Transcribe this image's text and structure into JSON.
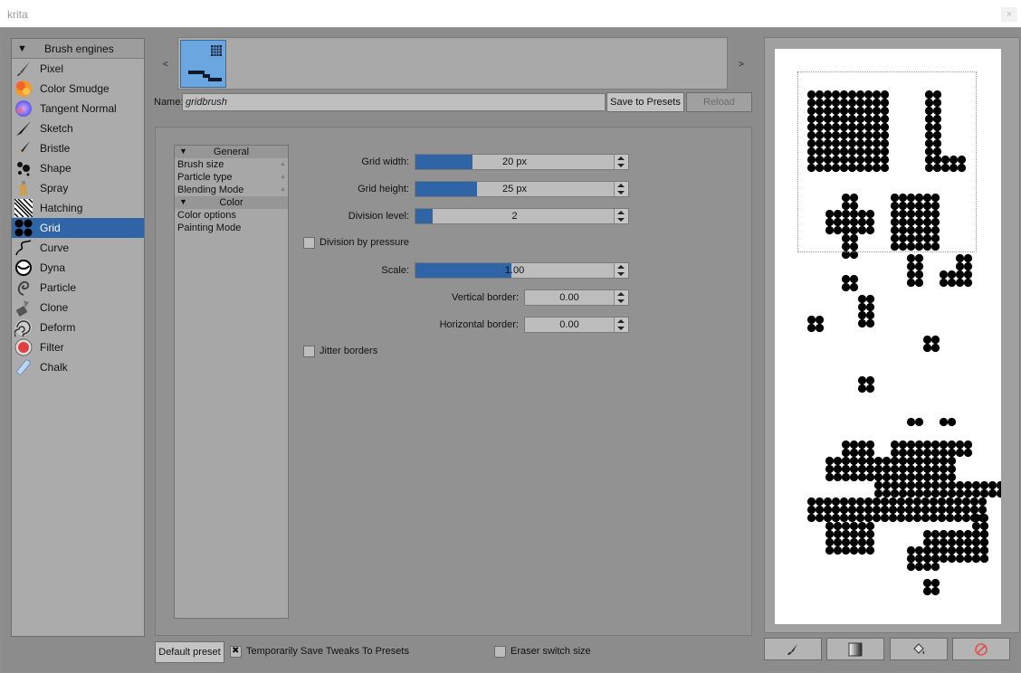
{
  "window": {
    "title": "krita",
    "close_label": "×"
  },
  "engines": {
    "header": "Brush engines",
    "items": [
      {
        "label": "Pixel",
        "icon": "pixel-brush-icon"
      },
      {
        "label": "Color Smudge",
        "icon": "color-smudge-icon"
      },
      {
        "label": "Tangent Normal",
        "icon": "tangent-normal-icon"
      },
      {
        "label": "Sketch",
        "icon": "sketch-icon"
      },
      {
        "label": "Bristle",
        "icon": "bristle-icon"
      },
      {
        "label": "Shape",
        "icon": "shape-icon"
      },
      {
        "label": "Spray",
        "icon": "spray-icon"
      },
      {
        "label": "Hatching",
        "icon": "hatching-icon"
      },
      {
        "label": "Grid",
        "icon": "grid-icon",
        "selected": true
      },
      {
        "label": "Curve",
        "icon": "curve-icon"
      },
      {
        "label": "Dyna",
        "icon": "dyna-icon"
      },
      {
        "label": "Particle",
        "icon": "particle-icon"
      },
      {
        "label": "Clone",
        "icon": "clone-icon"
      },
      {
        "label": "Deform",
        "icon": "deform-icon"
      },
      {
        "label": "Filter",
        "icon": "filter-icon"
      },
      {
        "label": "Chalk",
        "icon": "chalk-icon"
      }
    ]
  },
  "presets": {
    "prev": "<",
    "next": ">"
  },
  "name": {
    "label": "Name:",
    "value": "gridbrush",
    "save": "Save to Presets",
    "reload": "Reload"
  },
  "options": {
    "categories": [
      {
        "label": "General",
        "items": [
          "Brush size",
          "Particle type",
          "Blending Mode"
        ]
      },
      {
        "label": "Color",
        "items": [
          "Color options",
          "Painting Mode"
        ]
      }
    ]
  },
  "settings": {
    "grid_width": {
      "label": "Grid width:",
      "value": "20 px",
      "fill": 0.27
    },
    "grid_height": {
      "label": "Grid height:",
      "value": "25 px",
      "fill": 0.29
    },
    "division_level": {
      "label": "Division level:",
      "value": "2",
      "fill": 0.08
    },
    "division_by_pressure": {
      "label": "Division by pressure",
      "checked": false
    },
    "scale": {
      "label": "Scale:",
      "value": "1.00",
      "fill": 0.45
    },
    "vertical_border": {
      "label": "Vertical border:",
      "value": "0.00"
    },
    "horizontal_border": {
      "label": "Horizontal border:",
      "value": "0.00"
    },
    "jitter_borders": {
      "label": "Jitter borders",
      "checked": false
    }
  },
  "footer": {
    "default_preset": "Default preset",
    "temp_save": "Temporarily Save Tweaks To Presets",
    "temp_save_checked": true,
    "eraser_switch": "Eraser switch size",
    "eraser_switch_checked": false
  },
  "colors": {
    "accent": "#2f65a6"
  }
}
